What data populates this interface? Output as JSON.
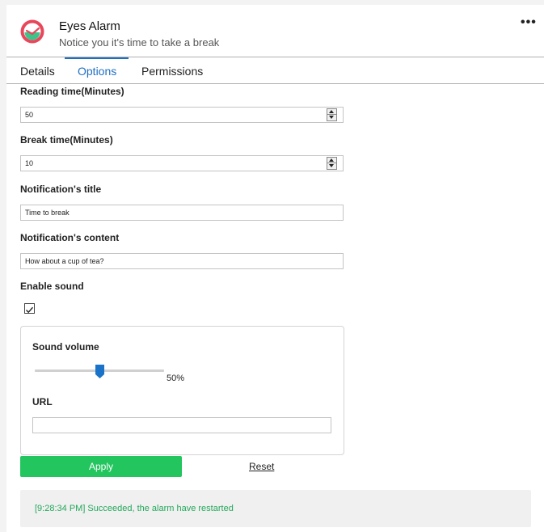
{
  "header": {
    "title": "Eyes Alarm",
    "subtitle": "Notice you it's time to take a break",
    "more_label": "•••"
  },
  "tabs": [
    {
      "label": "Details",
      "active": false
    },
    {
      "label": "Options",
      "active": true
    },
    {
      "label": "Permissions",
      "active": false
    }
  ],
  "form": {
    "reading_time": {
      "label": "Reading time(Minutes)",
      "value": "50"
    },
    "break_time": {
      "label": "Break time(Minutes)",
      "value": "10"
    },
    "notification_title": {
      "label": "Notification's title",
      "value": "Time to break"
    },
    "notification_content": {
      "label": "Notification's content",
      "value": "How about a cup of tea?"
    },
    "enable_sound": {
      "label": "Enable sound",
      "checked": true
    },
    "sound_volume": {
      "label": "Sound volume",
      "value": 50,
      "value_text": "50%"
    },
    "url": {
      "label": "URL",
      "value": ""
    }
  },
  "actions": {
    "apply_label": "Apply",
    "reset_label": "Reset"
  },
  "status": {
    "message": "[9:28:34 PM] Succeeded, the alarm have restarted"
  },
  "colors": {
    "accent": "#1e6fc2",
    "apply": "#22c55e",
    "status_text": "#22a85a",
    "icon_ring": "#e8465b",
    "icon_face": "#3cc48a"
  }
}
